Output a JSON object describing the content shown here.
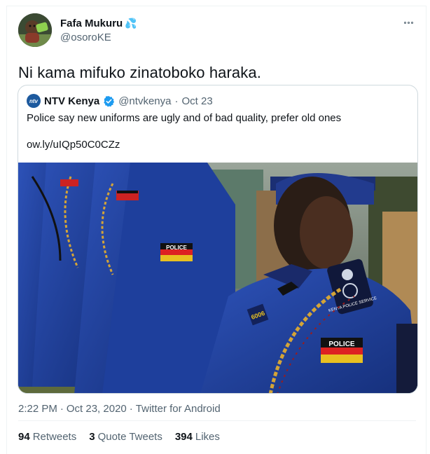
{
  "author": {
    "display_name": "Fafa Mukuru",
    "emoji": "💦",
    "handle": "@osoroKE",
    "avatar_icon": "profile-photo"
  },
  "tweet": {
    "text": "Ni kama mifuko zinatoboko haraka."
  },
  "quoted_tweet": {
    "display_name": "NTV Kenya",
    "avatar_label": "ntv",
    "verified": true,
    "handle": "@ntvkenya",
    "separator": "·",
    "date": "Oct 23",
    "text": "Police say new uniforms are ugly and of bad quality, prefer old ones",
    "link": "ow.ly/uIQp50C0CZz",
    "photo_badge_labels": {
      "police": "POLICE",
      "rank": "6006",
      "service": "KENYA POLICE SERVICE"
    }
  },
  "meta": {
    "time": "2:22 PM",
    "date": "Oct 23, 2020",
    "separator": "·",
    "source": "Twitter for Android"
  },
  "stats": {
    "retweets_count": "94",
    "retweets_label": "Retweets",
    "quotes_count": "3",
    "quotes_label": "Quote Tweets",
    "likes_count": "394",
    "likes_label": "Likes"
  },
  "colors": {
    "verified": "#1d9bf0",
    "uniform": "#1f3f9a",
    "secondary_text": "#536471"
  }
}
